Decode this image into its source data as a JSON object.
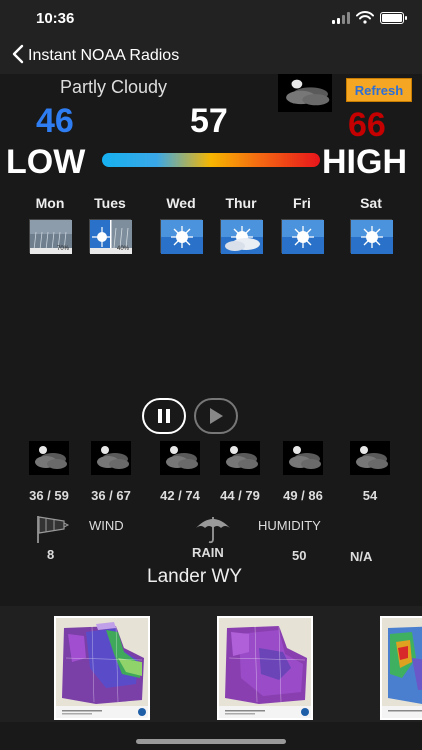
{
  "status": {
    "time": "10:36"
  },
  "nav": {
    "back_label": "Instant NOAA Radios"
  },
  "current": {
    "condition": "Partly Cloudy",
    "low": "46",
    "now": "57",
    "high": "66",
    "refresh_label": "Refresh",
    "low_label": "LOW",
    "high_label": "HIGH"
  },
  "forecast": [
    {
      "day": "Mon",
      "pct": "70%",
      "icon": "rain-icon"
    },
    {
      "day": "Tues",
      "pct": "40%",
      "icon": "sun-rain-icon"
    },
    {
      "day": "Wed",
      "pct": "",
      "icon": "sun-icon"
    },
    {
      "day": "Thur",
      "pct": "",
      "icon": "sun-cloud-icon"
    },
    {
      "day": "Fri",
      "pct": "",
      "icon": "sun-icon"
    },
    {
      "day": "Sat",
      "pct": "",
      "icon": "sun-icon"
    }
  ],
  "nights": [
    {
      "temps": "36 / 59"
    },
    {
      "temps": "36 / 67"
    },
    {
      "temps": "42 / 74"
    },
    {
      "temps": "44 / 79"
    },
    {
      "temps": "49 / 86"
    },
    {
      "temps": "54"
    }
  ],
  "details": {
    "wind_label": "WIND",
    "wind_value": "8",
    "rain_label": "RAIN",
    "humidity_label": "HUMIDITY",
    "humidity_value": "50",
    "rain_value": "N/A"
  },
  "location": "Lander WY",
  "colors": {
    "low": "#2f7df2",
    "high": "#c40000",
    "refresh_bg": "#f5a623",
    "refresh_text": "#2d6fd6"
  }
}
